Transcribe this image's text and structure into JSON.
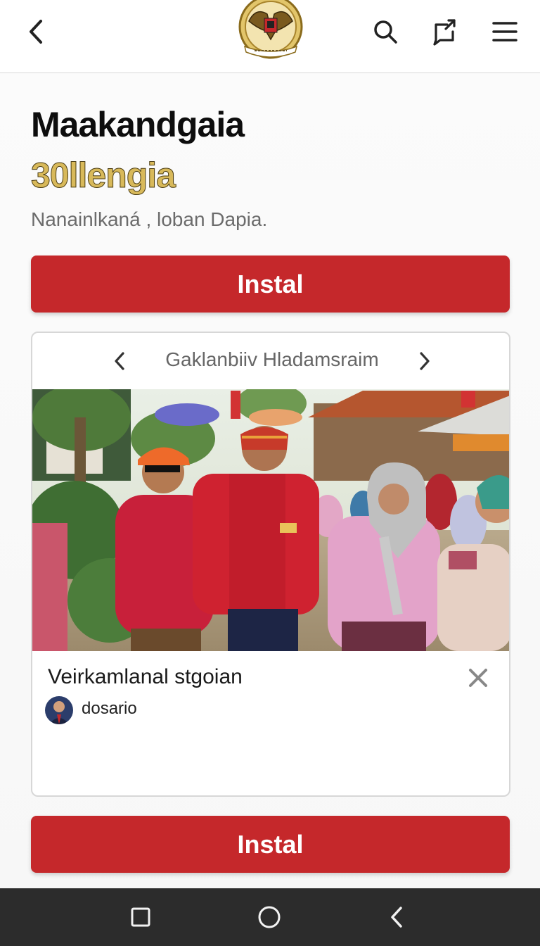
{
  "header": {
    "back_icon": "chevron-left-icon",
    "emblem_icon": "garuda-emblem-icon",
    "search_icon": "search-icon",
    "share_icon": "share-icon",
    "menu_icon": "hamburger-menu-icon"
  },
  "app": {
    "title": "Maakandgaia",
    "subtitle": "30llengia",
    "tagline": "Nanainlkaná , loban Dapia.",
    "install_label": "Instal"
  },
  "card": {
    "carousel_title": "Gaklanbiiv Hladamsraim",
    "prev_icon": "chevron-left-icon",
    "next_icon": "chevron-right-icon",
    "caption": "Veirkamlanal stgoian",
    "close_icon": "close-icon",
    "author": "dosario"
  },
  "footer": {
    "install_label": "Instal"
  },
  "system_nav": {
    "recent_icon": "square-icon",
    "home_icon": "circle-icon",
    "back_icon": "triangle-back-icon"
  },
  "colors": {
    "accent": "#c5282b",
    "subtitle_gold": "#d8b95a",
    "nav_bar": "#2c2c2c"
  }
}
